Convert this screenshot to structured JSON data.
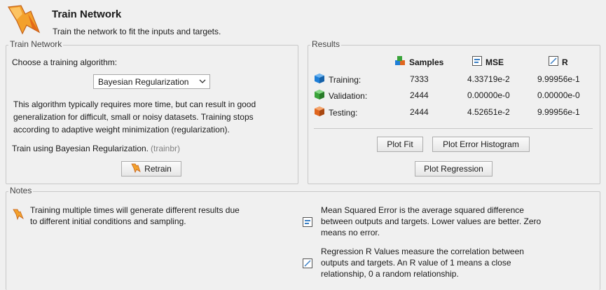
{
  "header": {
    "title": "Train Network",
    "subtitle": "Train the network to fit the inputs and targets."
  },
  "train_panel": {
    "title": "Train Network",
    "choose_label": "Choose a training algorithm:",
    "algorithm_selected": "Bayesian Regularization",
    "description": "This algorithm typically requires more time, but can result in good generalization for difficult, small or noisy datasets. Training stops according to adaptive weight minimization (regularization).",
    "train_using": "Train using Bayesian Regularization.",
    "train_code": "(trainbr)",
    "retrain_label": "Retrain"
  },
  "results_panel": {
    "title": "Results",
    "columns": [
      "Samples",
      "MSE",
      "R"
    ],
    "rows": [
      {
        "label": "Training:",
        "samples": "7333",
        "mse": "4.33719e-2",
        "r": "9.99956e-1",
        "color": "#1e7fd8"
      },
      {
        "label": "Validation:",
        "samples": "2444",
        "mse": "0.00000e-0",
        "r": "0.00000e-0",
        "color": "#3aa33a"
      },
      {
        "label": "Testing:",
        "samples": "2444",
        "mse": "4.52651e-2",
        "r": "9.99956e-1",
        "color": "#e0661e"
      }
    ],
    "buttons": {
      "plot_fit": "Plot Fit",
      "plot_error_histogram": "Plot Error Histogram",
      "plot_regression": "Plot Regression"
    }
  },
  "notes_panel": {
    "title": "Notes",
    "note_training": "Training multiple times will generate different results due to different initial conditions and sampling.",
    "note_mse": "Mean Squared Error is the average squared difference between outputs and targets. Lower values are better. Zero means no error.",
    "note_r": "Regression R Values measure the correlation between outputs and targets. An R value of 1 means a close relationship, 0 a random relationship."
  },
  "colors": {
    "accent_orange": "#f08a1c",
    "panel_border": "#c8c8c8",
    "background": "#f0f0f0"
  }
}
